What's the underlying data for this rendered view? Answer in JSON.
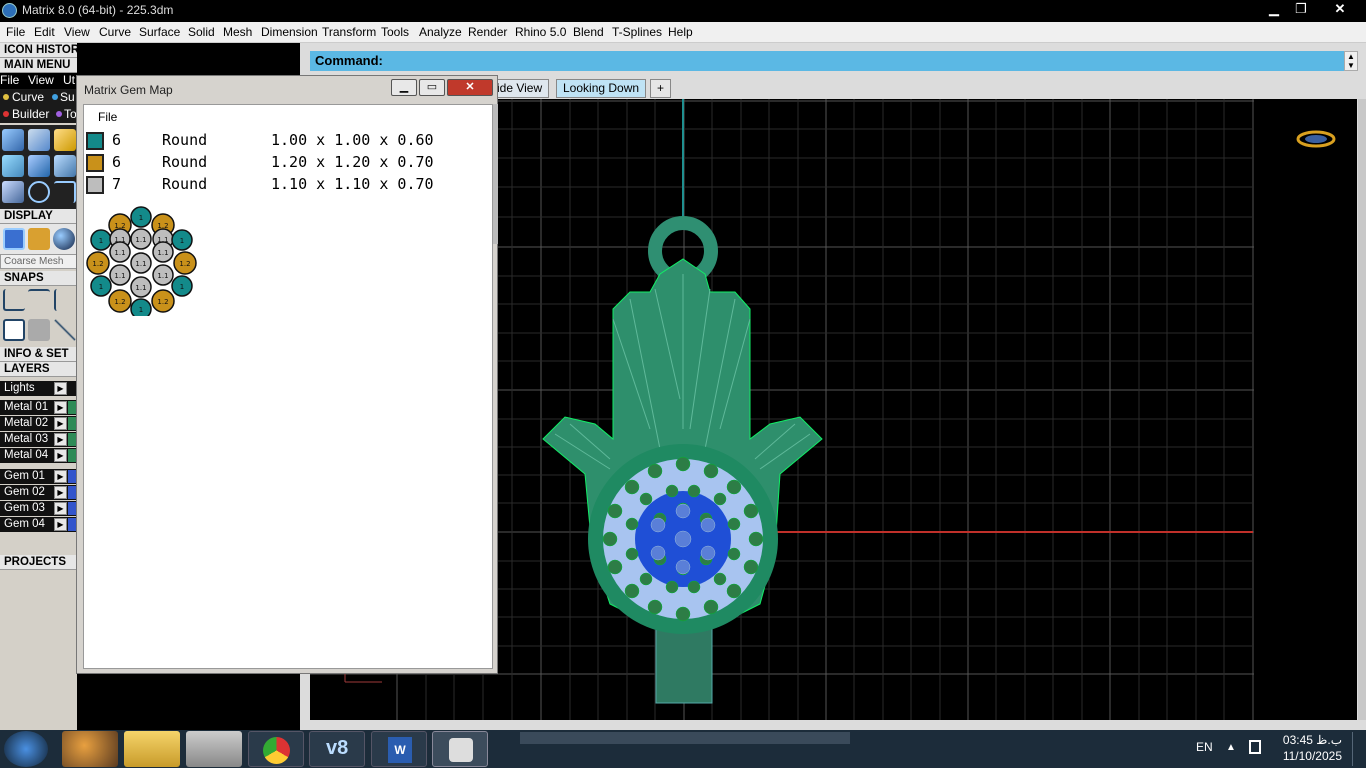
{
  "window": {
    "title": "Matrix 8.0 (64-bit) - 225.3dm",
    "minimize": "▁",
    "maximize": "❐",
    "close": "✕"
  },
  "menu": [
    "File",
    "Edit",
    "View",
    "Curve",
    "Surface",
    "Solid",
    "Mesh",
    "Dimension",
    "Transform",
    "Tools",
    "Analyze",
    "Render",
    "Rhino 5.0",
    "Blend",
    "T-Splines",
    "Help"
  ],
  "left_panel": {
    "icon_history": "ICON HISTORY",
    "main_menu": "MAIN MENU",
    "sub_menu": [
      "File",
      "View",
      "Ut"
    ],
    "sub_items": [
      "Curve",
      "Su",
      "Builder",
      "To"
    ],
    "display": "DISPLAY",
    "coarse_mesh": "Coarse Mesh",
    "snaps": "SNAPS",
    "info": "INFO & SET",
    "layers": "LAYERS",
    "layer_rows": [
      {
        "name": "Lights",
        "color": "#111111"
      },
      {
        "name": "Metal 01",
        "color": "#2e8b57"
      },
      {
        "name": "Metal 02",
        "color": "#2e8b57"
      },
      {
        "name": "Metal 03",
        "color": "#2e8b57"
      },
      {
        "name": "Metal 04",
        "color": "#2e8b57"
      },
      {
        "name": "Gem 01",
        "color": "#3355cc"
      },
      {
        "name": "Gem 02",
        "color": "#3355cc"
      },
      {
        "name": "Gem 03",
        "color": "#3355cc"
      },
      {
        "name": "Gem 04",
        "color": "#3355cc"
      }
    ],
    "projects": "PROJECTS"
  },
  "gem_map": {
    "title": "Matrix Gem Map",
    "file_menu": "File",
    "rows": [
      {
        "count": "6",
        "shape": "Round",
        "size": "1.00 x 1.00 x 0.60",
        "color": "#138a8a"
      },
      {
        "count": "6",
        "shape": "Round",
        "size": "1.20 x 1.20 x 0.70",
        "color": "#c9911a"
      },
      {
        "count": "7",
        "shape": "Round",
        "size": "1.10 x 1.10 x 0.70",
        "color": "#bdbdbd"
      }
    ],
    "diagram_labels": {
      "teal": "1",
      "gold": "1.2",
      "gray": "1.1"
    }
  },
  "viewport": {
    "command_label": "Command:",
    "tabs": [
      "ide View",
      "Looking Down",
      "+"
    ]
  },
  "taskbar": {
    "language": "EN",
    "time": "03:45 ب.ظ",
    "date": "11/10/2025"
  }
}
